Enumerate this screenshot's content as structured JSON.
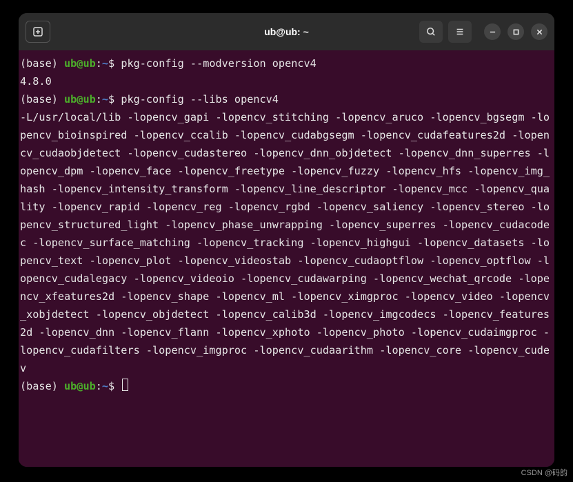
{
  "window": {
    "title": "ub@ub: ~"
  },
  "prompt": {
    "base": "(base) ",
    "userhost": "ub@ub",
    "colon": ":",
    "path": "~",
    "dollar": "$ "
  },
  "lines": {
    "cmd1": "pkg-config --modversion opencv4",
    "out1": "4.8.0",
    "cmd2": "pkg-config --libs opencv4",
    "out2": "-L/usr/local/lib -lopencv_gapi -lopencv_stitching -lopencv_aruco -lopencv_bgsegm -lopencv_bioinspired -lopencv_ccalib -lopencv_cudabgsegm -lopencv_cudafeatures2d -lopencv_cudaobjdetect -lopencv_cudastereo -lopencv_dnn_objdetect -lopencv_dnn_superres -lopencv_dpm -lopencv_face -lopencv_freetype -lopencv_fuzzy -lopencv_hfs -lopencv_img_hash -lopencv_intensity_transform -lopencv_line_descriptor -lopencv_mcc -lopencv_quality -lopencv_rapid -lopencv_reg -lopencv_rgbd -lopencv_saliency -lopencv_stereo -lopencv_structured_light -lopencv_phase_unwrapping -lopencv_superres -lopencv_cudacodec -lopencv_surface_matching -lopencv_tracking -lopencv_highgui -lopencv_datasets -lopencv_text -lopencv_plot -lopencv_videostab -lopencv_cudaoptflow -lopencv_optflow -lopencv_cudalegacy -lopencv_videoio -lopencv_cudawarping -lopencv_wechat_qrcode -lopencv_xfeatures2d -lopencv_shape -lopencv_ml -lopencv_ximgproc -lopencv_video -lopencv_xobjdetect -lopencv_objdetect -lopencv_calib3d -lopencv_imgcodecs -lopencv_features2d -lopencv_dnn -lopencv_flann -lopencv_xphoto -lopencv_photo -lopencv_cudaimgproc -lopencv_cudafilters -lopencv_imgproc -lopencv_cudaarithm -lopencv_core -lopencv_cudev"
  },
  "watermark": "CSDN @码韵"
}
